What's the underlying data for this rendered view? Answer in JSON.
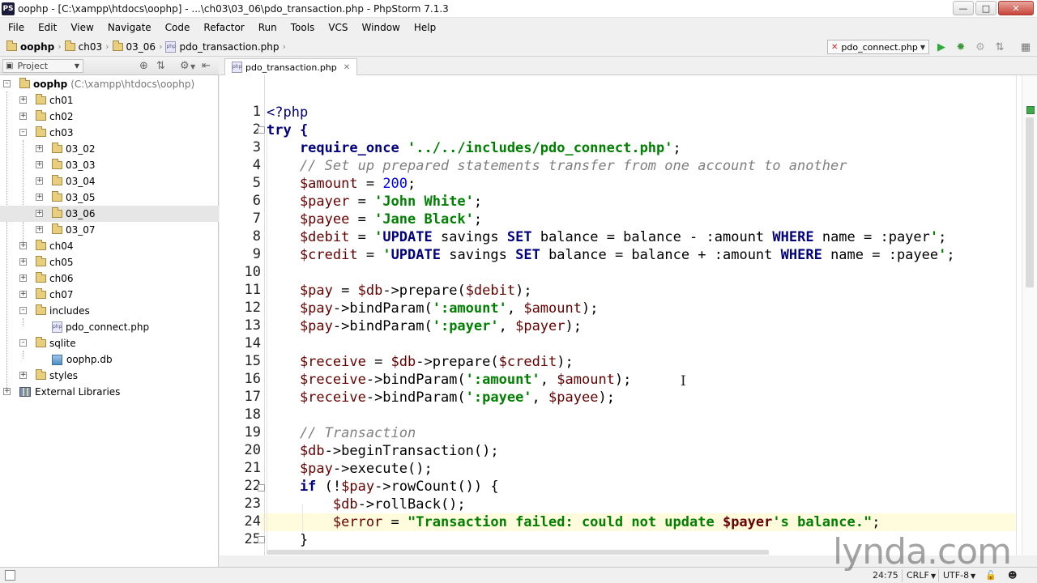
{
  "window": {
    "title": "oophp - [C:\\xampp\\htdocs\\oophp] - ...\\ch03\\03_06\\pdo_transaction.php - PhpStorm 7.1.3",
    "app_icon_text": "PS"
  },
  "menu": [
    "File",
    "Edit",
    "View",
    "Navigate",
    "Code",
    "Refactor",
    "Run",
    "Tools",
    "VCS",
    "Window",
    "Help"
  ],
  "breadcrumbs": [
    "oophp",
    "ch03",
    "03_06",
    "pdo_transaction.php"
  ],
  "run_config": "pdo_connect.php",
  "project_panel": {
    "title": "Project",
    "tree": [
      {
        "label": "oophp",
        "suffix": "(C:\\xampp\\htdocs\\oophp)"
      },
      {
        "label": "ch01"
      },
      {
        "label": "ch02"
      },
      {
        "label": "ch03"
      },
      {
        "label": "03_02"
      },
      {
        "label": "03_03"
      },
      {
        "label": "03_04"
      },
      {
        "label": "03_05"
      },
      {
        "label": "03_06"
      },
      {
        "label": "03_07"
      },
      {
        "label": "ch04"
      },
      {
        "label": "ch05"
      },
      {
        "label": "ch06"
      },
      {
        "label": "ch07"
      },
      {
        "label": "includes"
      },
      {
        "label": "pdo_connect.php"
      },
      {
        "label": "sqlite"
      },
      {
        "label": "oophp.db"
      },
      {
        "label": "styles"
      },
      {
        "label": "External Libraries"
      }
    ]
  },
  "editor": {
    "tab": "pdo_transaction.php",
    "line_numbers": [
      "1",
      "2",
      "3",
      "4",
      "5",
      "6",
      "7",
      "8",
      "9",
      "10",
      "11",
      "12",
      "13",
      "14",
      "15",
      "16",
      "17",
      "18",
      "19",
      "20",
      "21",
      "22",
      "23",
      "24",
      "25"
    ],
    "code": {
      "l1": "<?php",
      "l2": "try {",
      "l3a": "    require_once ",
      "l3b": "'../../includes/pdo_connect.php'",
      "l3c": ";",
      "l4": "    // Set up prepared statements transfer from one account to another",
      "l5a": "    $amount",
      "l5b": " = ",
      "l5c": "200",
      "l5d": ";",
      "l6a": "    $payer",
      "l6b": " = ",
      "l6c": "'John White'",
      "l6d": ";",
      "l7a": "    $payee",
      "l7b": " = ",
      "l7c": "'Jane Black'",
      "l7d": ";",
      "l8a": "    $debit",
      "l8b": " = ",
      "l8c": "'",
      "l8d": "UPDATE",
      "l8e": " savings ",
      "l8f": "SET",
      "l8g": " balance = balance - :amount ",
      "l8h": "WHERE",
      "l8i": " name = :payer",
      "l8j": "'",
      "l8k": ";",
      "l9a": "    $credit",
      "l9b": " = ",
      "l9c": "'",
      "l9d": "UPDATE",
      "l9e": " savings ",
      "l9f": "SET",
      "l9g": " balance = balance + :amount ",
      "l9h": "WHERE",
      "l9i": " name = :payee",
      "l9j": "'",
      "l9k": ";",
      "l11a": "    $pay",
      "l11b": " = ",
      "l11c": "$db",
      "l11d": "->prepare(",
      "l11e": "$debit",
      "l11f": ");",
      "l12a": "    $pay",
      "l12b": "->bindParam(",
      "l12c": "':amount'",
      "l12d": ", ",
      "l12e": "$amount",
      "l12f": ");",
      "l13a": "    $pay",
      "l13b": "->bindParam(",
      "l13c": "':payer'",
      "l13d": ", ",
      "l13e": "$payer",
      "l13f": ");",
      "l15a": "    $receive",
      "l15b": " = ",
      "l15c": "$db",
      "l15d": "->prepare(",
      "l15e": "$credit",
      "l15f": ");",
      "l16a": "    $receive",
      "l16b": "->bindParam(",
      "l16c": "':amount'",
      "l16d": ", ",
      "l16e": "$amount",
      "l16f": ");",
      "l17a": "    $receive",
      "l17b": "->bindParam(",
      "l17c": "':payee'",
      "l17d": ", ",
      "l17e": "$payee",
      "l17f": ");",
      "l19": "    // Transaction",
      "l20a": "    $db",
      "l20b": "->beginTransaction();",
      "l21a": "    $pay",
      "l21b": "->execute();",
      "l22a": "    if",
      "l22b": " (!",
      "l22c": "$pay",
      "l22d": "->rowCount()) {",
      "l23a": "        $db",
      "l23b": "->rollBack();",
      "l24a": "        $error",
      "l24b": " = ",
      "l24c": "\"Transaction failed: could not update ",
      "l24d": "$payer",
      "l24e": "'s balance.\"",
      "l24f": ";",
      "l25": "    }"
    }
  },
  "status": {
    "position": "24:75",
    "line_sep": "CRLF",
    "encoding": "UTF-8"
  },
  "watermark": "lynda.com"
}
